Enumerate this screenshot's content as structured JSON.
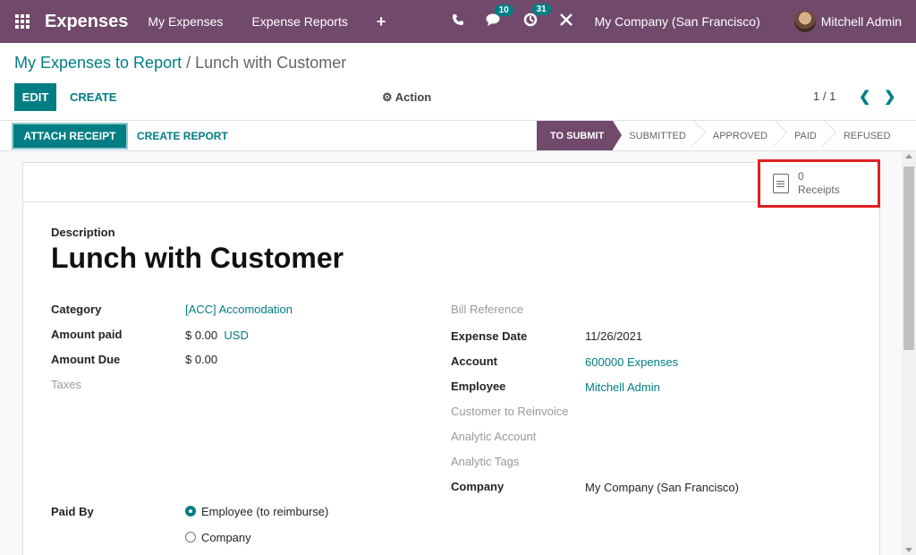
{
  "navbar": {
    "brand": "Expenses",
    "menu": [
      "My Expenses",
      "Expense Reports"
    ],
    "plus": "+",
    "messages_count": "10",
    "activities_count": "31",
    "company": "My Company (San Francisco)",
    "user": "Mitchell Admin"
  },
  "breadcrumb": {
    "parent": "My Expenses to Report",
    "separator": "/",
    "current": "Lunch with Customer"
  },
  "control_panel": {
    "edit": "EDIT",
    "create": "CREATE",
    "action": "Action",
    "pager": "1 / 1"
  },
  "statusbar": {
    "attach_receipt": "ATTACH RECEIPT",
    "create_report": "CREATE REPORT",
    "stages": [
      "TO SUBMIT",
      "SUBMITTED",
      "APPROVED",
      "PAID",
      "REFUSED"
    ],
    "active_stage": "TO SUBMIT"
  },
  "receipts": {
    "count": "0",
    "label": "Receipts"
  },
  "form": {
    "description_label": "Description",
    "title": "Lunch with Customer",
    "left": {
      "category_label": "Category",
      "category_value": "[ACC] Accomodation",
      "amount_paid_label": "Amount paid",
      "amount_paid_value": "$ 0.00",
      "amount_paid_currency": "USD",
      "amount_due_label": "Amount Due",
      "amount_due_value": "$ 0.00",
      "taxes_label": "Taxes"
    },
    "right": {
      "bill_reference_label": "Bill Reference",
      "expense_date_label": "Expense Date",
      "expense_date_value": "11/26/2021",
      "account_label": "Account",
      "account_value": "600000 Expenses",
      "employee_label": "Employee",
      "employee_value": "Mitchell Admin",
      "customer_label": "Customer to Reinvoice",
      "analytic_account_label": "Analytic Account",
      "analytic_tags_label": "Analytic Tags",
      "company_label": "Company",
      "company_value": "My Company (San Francisco)"
    },
    "paid_by": {
      "label": "Paid By",
      "options": [
        "Employee (to reimburse)",
        "Company"
      ],
      "selected": "Employee (to reimburse)"
    }
  },
  "colors": {
    "navbar": "#71496b",
    "accent": "#017e84",
    "highlight_box": "#e02020"
  }
}
